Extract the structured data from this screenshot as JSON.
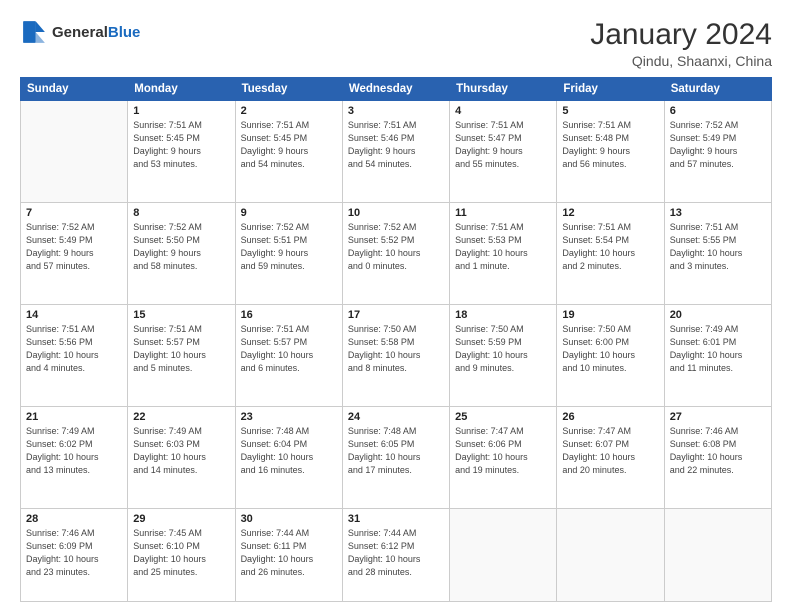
{
  "header": {
    "logo_general": "General",
    "logo_blue": "Blue",
    "title": "January 2024",
    "subtitle": "Qindu, Shaanxi, China"
  },
  "columns": [
    "Sunday",
    "Monday",
    "Tuesday",
    "Wednesday",
    "Thursday",
    "Friday",
    "Saturday"
  ],
  "weeks": [
    [
      {
        "day": "",
        "info": ""
      },
      {
        "day": "1",
        "info": "Sunrise: 7:51 AM\nSunset: 5:45 PM\nDaylight: 9 hours\nand 53 minutes."
      },
      {
        "day": "2",
        "info": "Sunrise: 7:51 AM\nSunset: 5:45 PM\nDaylight: 9 hours\nand 54 minutes."
      },
      {
        "day": "3",
        "info": "Sunrise: 7:51 AM\nSunset: 5:46 PM\nDaylight: 9 hours\nand 54 minutes."
      },
      {
        "day": "4",
        "info": "Sunrise: 7:51 AM\nSunset: 5:47 PM\nDaylight: 9 hours\nand 55 minutes."
      },
      {
        "day": "5",
        "info": "Sunrise: 7:51 AM\nSunset: 5:48 PM\nDaylight: 9 hours\nand 56 minutes."
      },
      {
        "day": "6",
        "info": "Sunrise: 7:52 AM\nSunset: 5:49 PM\nDaylight: 9 hours\nand 57 minutes."
      }
    ],
    [
      {
        "day": "7",
        "info": "Sunrise: 7:52 AM\nSunset: 5:49 PM\nDaylight: 9 hours\nand 57 minutes."
      },
      {
        "day": "8",
        "info": "Sunrise: 7:52 AM\nSunset: 5:50 PM\nDaylight: 9 hours\nand 58 minutes."
      },
      {
        "day": "9",
        "info": "Sunrise: 7:52 AM\nSunset: 5:51 PM\nDaylight: 9 hours\nand 59 minutes."
      },
      {
        "day": "10",
        "info": "Sunrise: 7:52 AM\nSunset: 5:52 PM\nDaylight: 10 hours\nand 0 minutes."
      },
      {
        "day": "11",
        "info": "Sunrise: 7:51 AM\nSunset: 5:53 PM\nDaylight: 10 hours\nand 1 minute."
      },
      {
        "day": "12",
        "info": "Sunrise: 7:51 AM\nSunset: 5:54 PM\nDaylight: 10 hours\nand 2 minutes."
      },
      {
        "day": "13",
        "info": "Sunrise: 7:51 AM\nSunset: 5:55 PM\nDaylight: 10 hours\nand 3 minutes."
      }
    ],
    [
      {
        "day": "14",
        "info": "Sunrise: 7:51 AM\nSunset: 5:56 PM\nDaylight: 10 hours\nand 4 minutes."
      },
      {
        "day": "15",
        "info": "Sunrise: 7:51 AM\nSunset: 5:57 PM\nDaylight: 10 hours\nand 5 minutes."
      },
      {
        "day": "16",
        "info": "Sunrise: 7:51 AM\nSunset: 5:57 PM\nDaylight: 10 hours\nand 6 minutes."
      },
      {
        "day": "17",
        "info": "Sunrise: 7:50 AM\nSunset: 5:58 PM\nDaylight: 10 hours\nand 8 minutes."
      },
      {
        "day": "18",
        "info": "Sunrise: 7:50 AM\nSunset: 5:59 PM\nDaylight: 10 hours\nand 9 minutes."
      },
      {
        "day": "19",
        "info": "Sunrise: 7:50 AM\nSunset: 6:00 PM\nDaylight: 10 hours\nand 10 minutes."
      },
      {
        "day": "20",
        "info": "Sunrise: 7:49 AM\nSunset: 6:01 PM\nDaylight: 10 hours\nand 11 minutes."
      }
    ],
    [
      {
        "day": "21",
        "info": "Sunrise: 7:49 AM\nSunset: 6:02 PM\nDaylight: 10 hours\nand 13 minutes."
      },
      {
        "day": "22",
        "info": "Sunrise: 7:49 AM\nSunset: 6:03 PM\nDaylight: 10 hours\nand 14 minutes."
      },
      {
        "day": "23",
        "info": "Sunrise: 7:48 AM\nSunset: 6:04 PM\nDaylight: 10 hours\nand 16 minutes."
      },
      {
        "day": "24",
        "info": "Sunrise: 7:48 AM\nSunset: 6:05 PM\nDaylight: 10 hours\nand 17 minutes."
      },
      {
        "day": "25",
        "info": "Sunrise: 7:47 AM\nSunset: 6:06 PM\nDaylight: 10 hours\nand 19 minutes."
      },
      {
        "day": "26",
        "info": "Sunrise: 7:47 AM\nSunset: 6:07 PM\nDaylight: 10 hours\nand 20 minutes."
      },
      {
        "day": "27",
        "info": "Sunrise: 7:46 AM\nSunset: 6:08 PM\nDaylight: 10 hours\nand 22 minutes."
      }
    ],
    [
      {
        "day": "28",
        "info": "Sunrise: 7:46 AM\nSunset: 6:09 PM\nDaylight: 10 hours\nand 23 minutes."
      },
      {
        "day": "29",
        "info": "Sunrise: 7:45 AM\nSunset: 6:10 PM\nDaylight: 10 hours\nand 25 minutes."
      },
      {
        "day": "30",
        "info": "Sunrise: 7:44 AM\nSunset: 6:11 PM\nDaylight: 10 hours\nand 26 minutes."
      },
      {
        "day": "31",
        "info": "Sunrise: 7:44 AM\nSunset: 6:12 PM\nDaylight: 10 hours\nand 28 minutes."
      },
      {
        "day": "",
        "info": ""
      },
      {
        "day": "",
        "info": ""
      },
      {
        "day": "",
        "info": ""
      }
    ]
  ]
}
